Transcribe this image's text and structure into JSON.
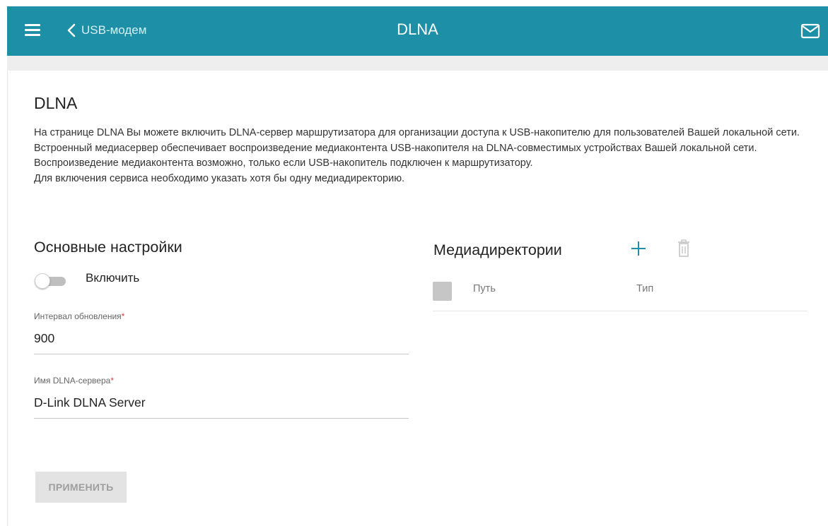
{
  "header": {
    "back_label": "USB-модем",
    "title": "DLNA"
  },
  "page": {
    "title": "DLNA",
    "description": [
      "На странице DLNA Вы можете включить DLNA-сервер маршрутизатора для организации доступа к USB-накопителю для пользователей Вашей локальной сети.",
      "Встроенный медиасервер обеспечивает воспроизведение медиаконтента USB-накопителя на DLNA-совместимых устройствах Вашей локальной сети. Воспроизведение медиаконтента возможно, только если USB-накопитель подключен к маршрутизатору.",
      "Для включения сервиса необходимо указать хотя бы одну медиадиректорию."
    ]
  },
  "basic": {
    "title": "Основные настройки",
    "enable_label": "Включить",
    "enabled": false,
    "interval_label": "Интервал обновления",
    "interval_value": "900",
    "name_label": "Имя DLNA-сервера",
    "name_value": "D-Link DLNA Server",
    "required_mark": "*",
    "apply_label": "ПРИМЕНИТЬ"
  },
  "media": {
    "title": "Медиадиректории",
    "columns": [
      "Путь",
      "Тип"
    ]
  },
  "icons": {
    "menu": "hamburger-menu-icon",
    "back": "chevron-left-icon",
    "mail": "mail-icon",
    "add": "plus-icon",
    "delete": "trash-icon"
  },
  "colors": {
    "header_bg": "#1d8fa6",
    "accent": "#1d8fa6",
    "required": "#e03b3b"
  }
}
